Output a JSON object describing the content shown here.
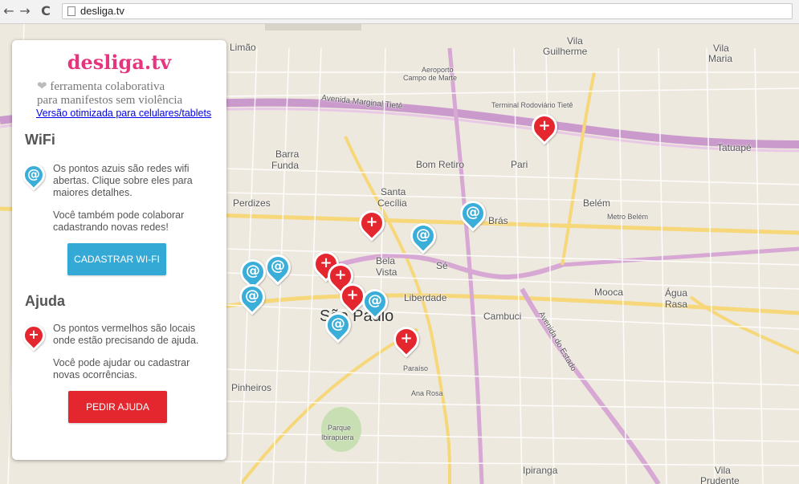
{
  "browser": {
    "back_icon": "←",
    "forward_icon": "→",
    "reload_icon": "C",
    "url": "desliga.tv"
  },
  "panel": {
    "brand": "desliga.tv",
    "heart_icon": "❤",
    "tagline_line1": "ferramenta colaborativa",
    "tagline_line2": "para manifestos sem violência",
    "mobile_link": "Versão otimizada para celulares/tablets",
    "wifi": {
      "title": "WiFi",
      "icon": "@",
      "desc1": "Os pontos azuis são redes wifi abertas. Clique sobre eles para maiores detalhes.",
      "desc2": "Você também pode colaborar cadastrando novas redes!",
      "button": "CADASTRAR WI-FI"
    },
    "ajuda": {
      "title": "Ajuda",
      "icon": "+",
      "desc1": "Os pontos vermelhos são locais onde estão precisando de ajuda.",
      "desc2": "Você pode ajudar ou cadastrar novas ocorrências.",
      "button": "PEDIR AJUDA"
    }
  },
  "map": {
    "labels": {
      "sao_paulo": "São Paulo",
      "bom_retiro": "Bom Retiro",
      "pari": "Pari",
      "bras": "Brás",
      "belem": "Belém",
      "mooca": "Mooca",
      "agua_rasa_1": "Água",
      "agua_rasa_2": "Rasa",
      "cambuci": "Cambuci",
      "liberdade": "Liberdade",
      "perdizes": "Perdizes",
      "barra_funda_1": "Barra",
      "barra_funda_2": "Funda",
      "bela_vista_1": "Bela",
      "bela_vista_2": "Vista",
      "santa_cecilia_1": "Santa",
      "santa_cecilia_2": "Cecília",
      "se": "Sé",
      "pinheiros": "Pinheiros",
      "ipiranga": "Ipiranga",
      "tatuape": "Tatuapé",
      "vila_guilherme_1": "Vila",
      "vila_guilherme_2": "Guilherme",
      "vila_maria_1": "Vila",
      "vila_maria_2": "Maria",
      "vila_prudente_1": "Vila",
      "vila_prudente_2": "Prudente",
      "limao": "Limão",
      "av_marginal": "Avenida Marginal Tietê",
      "av_estado": "Avenida do Estado",
      "aeroporto_1": "Aeroporto",
      "aeroporto_2": "Campo de Marte",
      "terminal_tiete": "Terminal Rodoviário Tietê",
      "parque_1": "Parque",
      "parque_2": "Ibirapuera",
      "paraiso": "Paraíso",
      "ana_rosa": "Ana Rosa",
      "metro_belem": "Metro Belém",
      "tatuape_small": "Tatuapé"
    },
    "wifi_icon": "@",
    "help_icon": "+"
  }
}
